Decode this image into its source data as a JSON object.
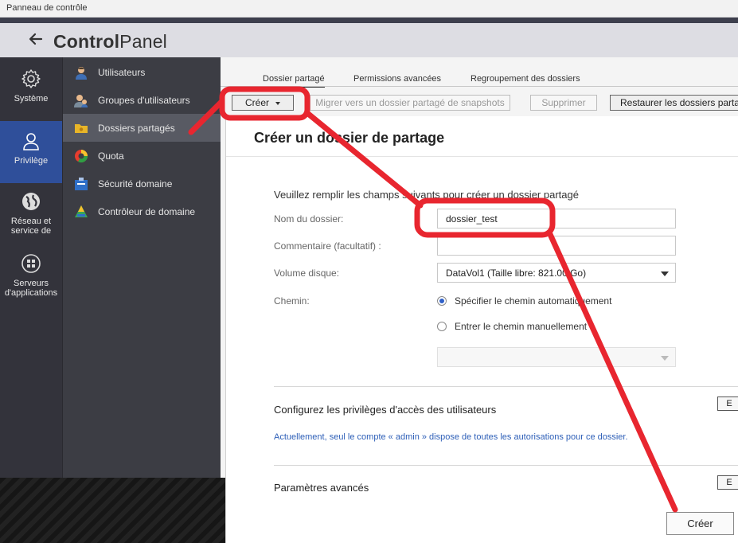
{
  "window": {
    "title": "Panneau de contrôle"
  },
  "app": {
    "title_bold": "Control",
    "title_light": "Panel"
  },
  "leftnav": [
    {
      "label": "Système",
      "icon": "gear-icon"
    },
    {
      "label": "Privilège",
      "icon": "user-icon",
      "active": true
    },
    {
      "label": "Réseau et service de",
      "icon": "globe-icon"
    },
    {
      "label": "Serveurs d'applications",
      "icon": "apps-icon"
    }
  ],
  "submenu": [
    {
      "label": "Utilisateurs",
      "icon": "user-icon"
    },
    {
      "label": "Groupes d'utilisateurs",
      "icon": "group-icon"
    },
    {
      "label": "Dossiers partagés",
      "icon": "folder-icon",
      "active": true
    },
    {
      "label": "Quota",
      "icon": "quota-icon"
    },
    {
      "label": "Sécurité domaine",
      "icon": "domain-security-icon"
    },
    {
      "label": "Contrôleur de domaine",
      "icon": "domain-controller-icon"
    }
  ],
  "tabs": [
    "Dossier partagé",
    "Permissions avancées",
    "Regroupement des dossiers"
  ],
  "toolbar": {
    "create": "Créer",
    "migrate": "Migrer vers un dossier partagé de snapshots",
    "delete": "Supprimer",
    "restore": "Restaurer les dossiers partag"
  },
  "dialog": {
    "title": "Créer un dossier de partage",
    "lead": "Veuillez remplir les champs suivants pour créer un dossier partagé",
    "folder_name_label": "Nom du dossier:",
    "folder_name_value": "dossier_test",
    "comment_label": "Commentaire (facultatif) :",
    "comment_value": "",
    "volume_label": "Volume disque:",
    "volume_value": "DataVol1 (Taille libre: 821.00 Go)",
    "path_label": "Chemin:",
    "path_auto": "Spécifier le chemin automatiquement",
    "path_manual": "Entrer le chemin manuellement",
    "privileges_title": "Configurez les privilèges d'accès des utilisateurs",
    "privileges_note": "Actuellement, seul le compte « admin » dispose de toutes les autorisations pour ce dossier.",
    "advanced_title": "Paramètres avancés",
    "side_button": "E",
    "create_button": "Créer"
  },
  "colors": {
    "accent": "#2f4f9a",
    "annotation": "#e8262f",
    "link": "#2f60b8"
  }
}
